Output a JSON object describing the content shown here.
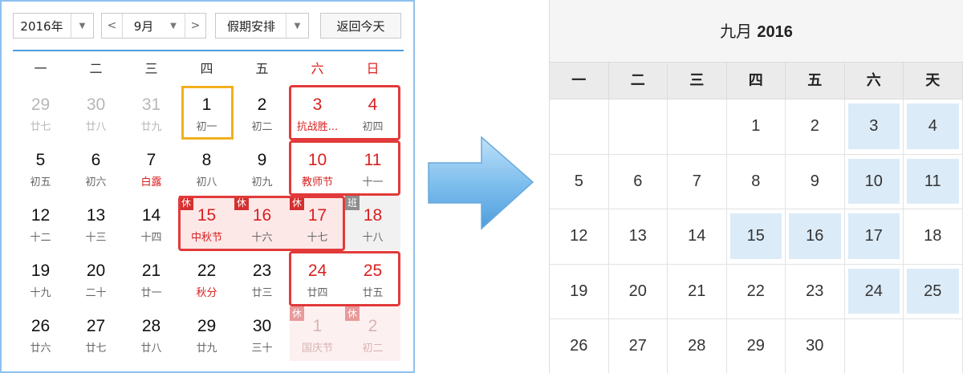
{
  "left": {
    "year_select": "2016年",
    "month_select": "9月",
    "holiday_select": "假期安排",
    "today_button": "返回今天",
    "prev_arrow": "<",
    "next_arrow": ">",
    "weekdays": [
      "一",
      "二",
      "三",
      "四",
      "五",
      "六",
      "日"
    ],
    "tags": {
      "rest": "休",
      "work": "班"
    },
    "days": [
      {
        "d": "29",
        "l": "廿七",
        "type": "other"
      },
      {
        "d": "30",
        "l": "廿八",
        "type": "other"
      },
      {
        "d": "31",
        "l": "廿九",
        "type": "other"
      },
      {
        "d": "1",
        "l": "初一",
        "type": "today"
      },
      {
        "d": "2",
        "l": "初二",
        "type": "normal"
      },
      {
        "d": "3",
        "l": "抗战胜...",
        "type": "weekend",
        "lred": true
      },
      {
        "d": "4",
        "l": "初四",
        "type": "weekend"
      },
      {
        "d": "5",
        "l": "初五",
        "type": "normal"
      },
      {
        "d": "6",
        "l": "初六",
        "type": "normal"
      },
      {
        "d": "7",
        "l": "白露",
        "type": "normal",
        "lred": true
      },
      {
        "d": "8",
        "l": "初八",
        "type": "normal"
      },
      {
        "d": "9",
        "l": "初九",
        "type": "normal"
      },
      {
        "d": "10",
        "l": "教师节",
        "type": "weekend",
        "lred": true
      },
      {
        "d": "11",
        "l": "十一",
        "type": "weekend"
      },
      {
        "d": "12",
        "l": "十二",
        "type": "normal"
      },
      {
        "d": "13",
        "l": "十三",
        "type": "normal"
      },
      {
        "d": "14",
        "l": "十四",
        "type": "normal"
      },
      {
        "d": "15",
        "l": "中秋节",
        "type": "rest",
        "lred": true
      },
      {
        "d": "16",
        "l": "十六",
        "type": "rest"
      },
      {
        "d": "17",
        "l": "十七",
        "type": "rest-weekend"
      },
      {
        "d": "18",
        "l": "十八",
        "type": "work"
      },
      {
        "d": "19",
        "l": "十九",
        "type": "normal"
      },
      {
        "d": "20",
        "l": "二十",
        "type": "normal"
      },
      {
        "d": "21",
        "l": "廿一",
        "type": "normal"
      },
      {
        "d": "22",
        "l": "秋分",
        "type": "normal",
        "lred": true
      },
      {
        "d": "23",
        "l": "廿三",
        "type": "normal"
      },
      {
        "d": "24",
        "l": "廿四",
        "type": "weekend"
      },
      {
        "d": "25",
        "l": "廿五",
        "type": "weekend"
      },
      {
        "d": "26",
        "l": "廿六",
        "type": "normal"
      },
      {
        "d": "27",
        "l": "廿七",
        "type": "normal"
      },
      {
        "d": "28",
        "l": "廿八",
        "type": "normal"
      },
      {
        "d": "29",
        "l": "廿九",
        "type": "normal"
      },
      {
        "d": "30",
        "l": "三十",
        "type": "normal"
      },
      {
        "d": "1",
        "l": "国庆节",
        "type": "restfade"
      },
      {
        "d": "2",
        "l": "初二",
        "type": "restfade"
      }
    ]
  },
  "right": {
    "title_month": "九月",
    "title_year": "2016",
    "weekdays": [
      "一",
      "二",
      "三",
      "四",
      "五",
      "六",
      "天"
    ],
    "days": [
      {
        "d": "",
        "hl": false
      },
      {
        "d": "",
        "hl": false
      },
      {
        "d": "",
        "hl": false
      },
      {
        "d": "1",
        "hl": false
      },
      {
        "d": "2",
        "hl": false
      },
      {
        "d": "3",
        "hl": true
      },
      {
        "d": "4",
        "hl": true
      },
      {
        "d": "5",
        "hl": false
      },
      {
        "d": "6",
        "hl": false
      },
      {
        "d": "7",
        "hl": false
      },
      {
        "d": "8",
        "hl": false
      },
      {
        "d": "9",
        "hl": false
      },
      {
        "d": "10",
        "hl": true
      },
      {
        "d": "11",
        "hl": true
      },
      {
        "d": "12",
        "hl": false
      },
      {
        "d": "13",
        "hl": false
      },
      {
        "d": "14",
        "hl": false
      },
      {
        "d": "15",
        "hl": true
      },
      {
        "d": "16",
        "hl": true
      },
      {
        "d": "17",
        "hl": true
      },
      {
        "d": "18",
        "hl": false
      },
      {
        "d": "19",
        "hl": false
      },
      {
        "d": "20",
        "hl": false
      },
      {
        "d": "21",
        "hl": false
      },
      {
        "d": "22",
        "hl": false
      },
      {
        "d": "23",
        "hl": false
      },
      {
        "d": "24",
        "hl": true
      },
      {
        "d": "25",
        "hl": true
      },
      {
        "d": "26",
        "hl": false
      },
      {
        "d": "27",
        "hl": false
      },
      {
        "d": "28",
        "hl": false
      },
      {
        "d": "29",
        "hl": false
      },
      {
        "d": "30",
        "hl": false
      },
      {
        "d": "",
        "hl": false
      },
      {
        "d": "",
        "hl": false
      }
    ]
  },
  "colors": {
    "accent_blue": "#4c9fe0",
    "holiday_red": "#d92020",
    "today_yellow": "#f2b01e",
    "highlight_blue": "#dcebf8"
  }
}
